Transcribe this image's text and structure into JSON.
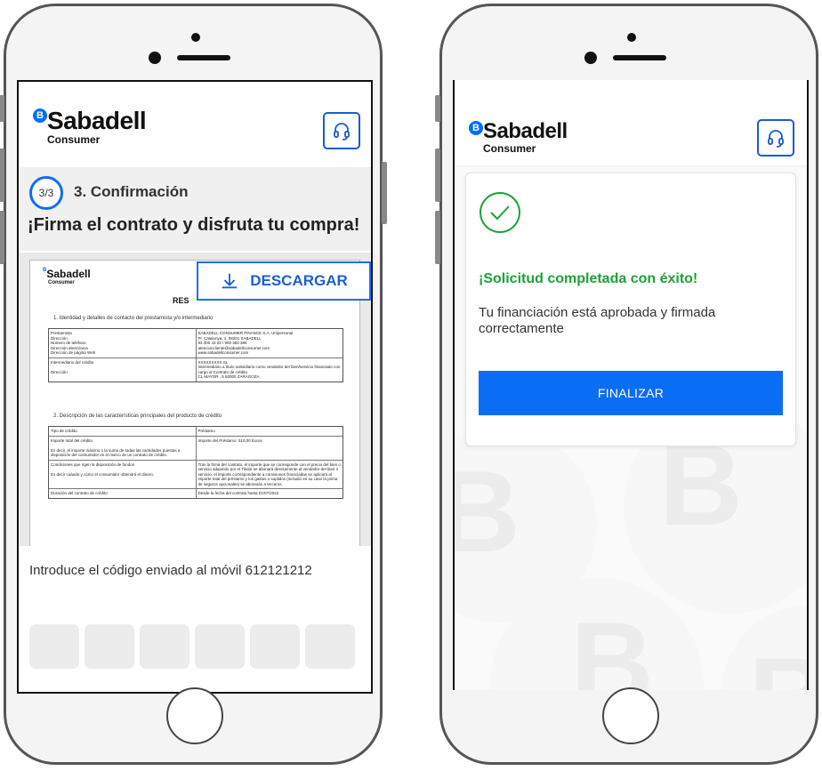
{
  "left_screen": {
    "logo": {
      "badge": "B",
      "word": "Sabadell",
      "sub": "Consumer"
    },
    "help_icon": "headset-icon",
    "step": {
      "counter": "3/3",
      "title": "3. Confirmación"
    },
    "headline": "¡Firma el contrato y disfruta tu compra!",
    "download_label": "DESCARGAR",
    "document": {
      "logo_word": "Sabadell",
      "logo_sub": "Consumer",
      "res_label": "RES",
      "section1": "1. Identidad y detalles de contacto del prestamista y/o intermediario",
      "table1": [
        [
          "Prestamista\nDirección\nNúmero de teléfono\nDirección electrónica\nDirección de página Web",
          "SABADELL CONSUMER FINANCE S.A. Unipersonal\nPl. Catalunya, 1, 08201 SABADELL\n93 400 43 02 / 900 383 386\natencioncliente@sabadellconsumer.com\nwww.sabadellconsumer.com"
        ],
        [
          "Intermediario del crédito\n\nDirección",
          "XXXXXXXXX SL\nIntermediario a título subsidiario como vendedor del bien/servicio financiado con cargo al Contrato de crédito\nCL MAYOR , 5 50000 ZARAGOZA"
        ]
      ],
      "section2": "2. Descripción de las características principales del producto de crédito",
      "table2": [
        [
          "Tipo de crédito",
          "Préstamo"
        ],
        [
          "Importe total del crédito\n\nEs decir, el importe máximo o la suma de todas las cantidades puestas a disposición del consumidor en el marco de un contrato de crédito.",
          "Importe del Préstamo:  510,00 Euros"
        ],
        [
          "Condiciones que rigen la disposición de fondos\n\nEs decir cuándo y cómo el consumidor obtendrá el dinero.",
          "Tras la firma del contrato, el importe que se corresponde con el precio del bien o servicio adquirido por el Titular se abonará directamente al vendedor del bien o servicio, el importe correspondiente a comisiones financiadas se aplicará al importe total del préstamo y los gastos o suplidos (incluido en su caso la prima de seguros opcionales) se abonarán a terceros."
        ],
        [
          "Duración del contrato de crédito",
          "Desde la fecha del contrato hasta  01/07/2022"
        ]
      ]
    },
    "code_prompt": "Introduce el código enviado al móvil 612121212",
    "code_slots": [
      "",
      "",
      "",
      "",
      "",
      ""
    ]
  },
  "right_screen": {
    "logo": {
      "badge": "B",
      "word": "Sabadell",
      "sub": "Consumer"
    },
    "help_icon": "headset-icon",
    "success_icon": "check-circle-icon",
    "success_title": "¡Solicitud completada con éxito!",
    "success_text": "Tu financiación está aprobada y firmada correctamente",
    "finalize_label": "FINALIZAR",
    "background_letters": [
      "B",
      "B",
      "B",
      "B"
    ]
  },
  "colors": {
    "brand_blue": "#0a6df5",
    "success_green": "#1ea238",
    "frame": "#555555"
  }
}
